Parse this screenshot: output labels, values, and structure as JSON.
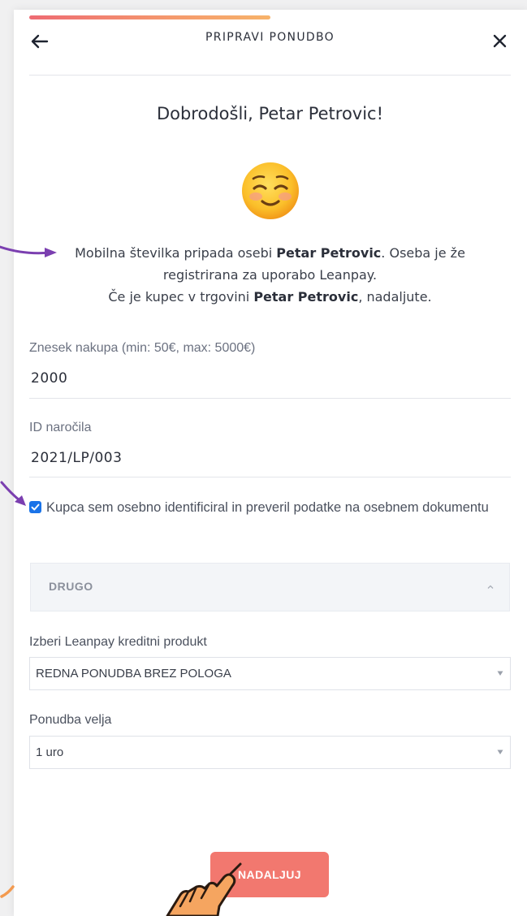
{
  "header": {
    "title": "PRIPRAVI PONUDBO",
    "back_icon": "arrow-left-icon",
    "close_icon": "close-icon"
  },
  "progress": {
    "fraction": 0.5
  },
  "welcome": {
    "title": "Dobrodošli, Petar Petrovic!",
    "emoji": "smiling-face-icon"
  },
  "info": {
    "line1_prefix": "Mobilna številka pripada osebi ",
    "line1_name": "Petar Petrovic",
    "line1_suffix": ". Oseba je že registrirana za uporabo Leanpay.",
    "line2_prefix": "Če je kupec v trgovini ",
    "line2_name": "Petar Petrovic",
    "line2_suffix": ", nadaljute."
  },
  "form": {
    "amount_label": "Znesek nakupa (min: 50€, max: 5000€)",
    "amount_value": "2000",
    "order_label": "ID naročila",
    "order_value": "2021/LP/003",
    "identity_check_label": "Kupca sem osebno identificiral in preveril podatke na osebnem dokumentu",
    "identity_checked": true,
    "accordion_label": "DRUGO",
    "product_label": "Izberi Leanpay kreditni produkt",
    "product_value": "REDNA PONUDBA BREZ POLOGA",
    "validity_label": "Ponudba velja",
    "validity_value": "1 uro",
    "submit_label": "NADALJUJ"
  },
  "colors": {
    "accent": "#f2786f",
    "annotation_arrow": "#7b3fb0",
    "checkbox": "#1a73e8"
  },
  "annotations": {
    "icons": [
      "annotation-arrow-icon",
      "pointing-hand-icon"
    ]
  }
}
